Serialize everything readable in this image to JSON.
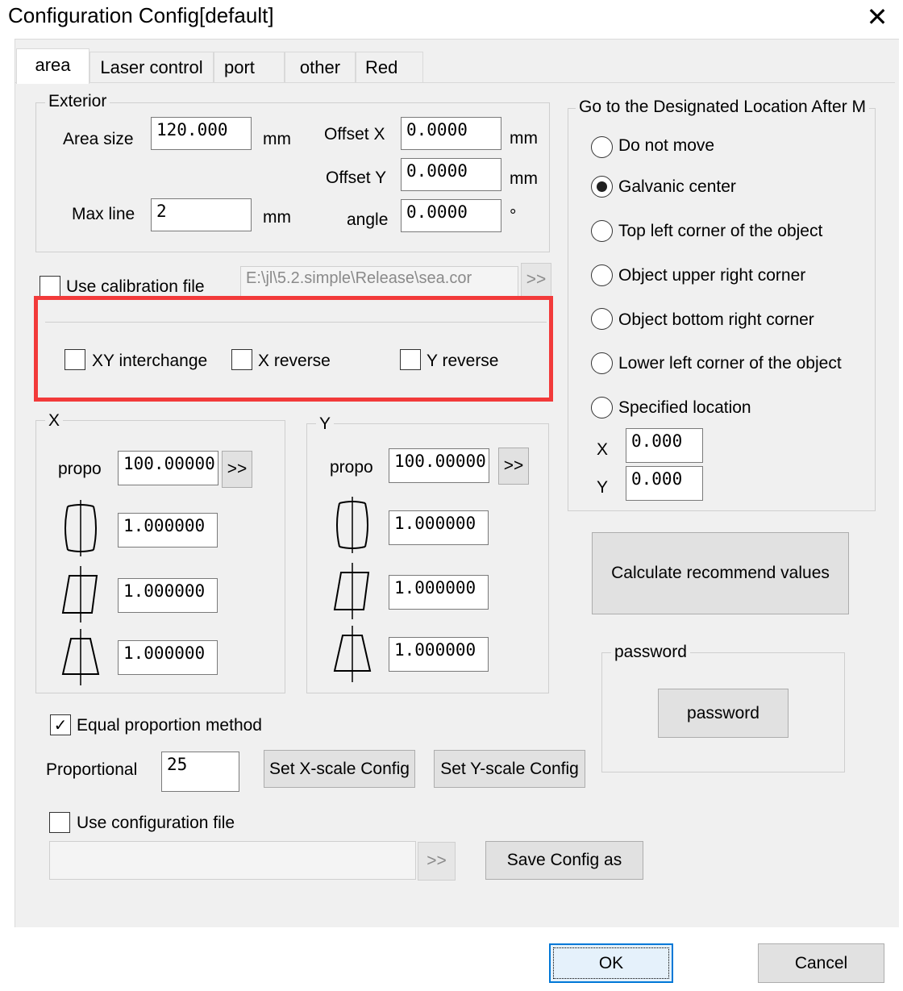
{
  "window": {
    "title": "Configuration Config[default]"
  },
  "tabs": [
    "area",
    "Laser control",
    "port",
    "other",
    "Red"
  ],
  "exterior": {
    "legend": "Exterior",
    "area_size_label": "Area size",
    "area_size_value": "120.000",
    "area_size_unit": "mm",
    "max_line_label": "Max line",
    "max_line_value": "2",
    "max_line_unit": "mm",
    "offset_x_label": "Offset X",
    "offset_x_value": "0.0000",
    "offset_x_unit": "mm",
    "offset_y_label": "Offset Y",
    "offset_y_value": "0.0000",
    "offset_y_unit": "mm",
    "angle_label": "angle",
    "angle_value": "0.0000",
    "angle_unit": "°"
  },
  "calibration": {
    "use_label": "Use calibration file",
    "path": "E:\\jl\\5.2.simple\\Release\\sea.cor",
    "browse": ">>"
  },
  "reverse": {
    "xy_interchange": "XY interchange",
    "x_reverse": "X reverse",
    "y_reverse": "Y reverse"
  },
  "x_group": {
    "legend": "X",
    "propo_label": "propo",
    "propo_value": "100.00000",
    "propo_btn": ">>",
    "barrel_value": "1.000000",
    "parallelogram_value": "1.000000",
    "trapezoid_value": "1.000000"
  },
  "y_group": {
    "legend": "Y",
    "propo_label": "propo",
    "propo_value": "100.00000",
    "propo_btn": ">>",
    "barrel_value": "1.000000",
    "parallelogram_value": "1.000000",
    "trapezoid_value": "1.000000"
  },
  "equal_proportion": {
    "label": "Equal proportion method",
    "checked": true
  },
  "proportional": {
    "label": "Proportional",
    "value": "25",
    "set_x": "Set X-scale Config",
    "set_y": "Set Y-scale Config"
  },
  "config_file": {
    "use_label": "Use configuration file",
    "path": "",
    "browse": ">>",
    "save_as": "Save Config as"
  },
  "goto": {
    "legend": "Go to the Designated Location After M",
    "options": [
      "Do not move",
      "Galvanic center",
      "Top left corner of the object",
      "Object upper right corner",
      "Object bottom right corner",
      "Lower left corner of the object",
      "Specified location"
    ],
    "selected_index": 1,
    "x_label": "X",
    "x_value": "0.000",
    "y_label": "Y",
    "y_value": "0.000"
  },
  "calculate": "Calculate recommend values",
  "password": {
    "legend": "password",
    "button": "password"
  },
  "dialog": {
    "ok": "OK",
    "cancel": "Cancel"
  },
  "colors": {
    "highlight": "#f23a3a",
    "dialog_bg": "#f0f0f0",
    "ok_border": "#0078d7"
  }
}
